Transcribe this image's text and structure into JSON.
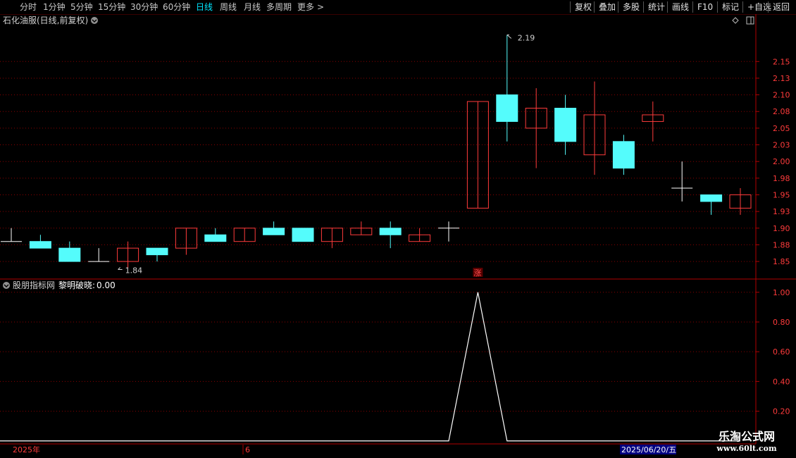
{
  "toolbar": {
    "periods": [
      "分时",
      "1分钟",
      "5分钟",
      "15分钟",
      "30分钟",
      "60分钟",
      "日线",
      "周线",
      "月线",
      "多周期",
      "更多"
    ],
    "active_index": 6,
    "buttons": [
      "复权",
      "叠加",
      "多股",
      "统计",
      "画线",
      "F10",
      "标记",
      "+自选",
      "返回"
    ]
  },
  "main_panel": {
    "title": "石化油服(日线,前复权)",
    "rise_marker": "涨",
    "high_label": "2.19",
    "low_label": "1.84"
  },
  "indicator_panel": {
    "source": "股朋指标网",
    "name": "黎明破晓",
    "value": "0.00"
  },
  "date_bar": {
    "year_label": "2025年",
    "month_label": "6",
    "cursor_date": "2025/06/20/五"
  },
  "watermark": {
    "line1": "乐淘公式网",
    "line2": "www.60lt.com"
  },
  "colors": {
    "up": "#ff3b3b",
    "down": "#54fcfc",
    "flat": "#ffffff",
    "grid": "#8b0000",
    "axis_text": "#ff3b3b",
    "indicator_line": "#ffffff"
  },
  "chart_data": [
    {
      "type": "candlestick",
      "title": "石化油服(日线,前复权)",
      "y_ticks": [
        "1.85",
        "1.88",
        "1.90",
        "1.93",
        "1.95",
        "1.98",
        "2.00",
        "2.03",
        "2.05",
        "2.08",
        "2.10",
        "2.13",
        "2.15"
      ],
      "y_tick_values": [
        1.85,
        1.875,
        1.9,
        1.925,
        1.95,
        1.975,
        2.0,
        2.025,
        2.05,
        2.075,
        2.1,
        2.125,
        2.15
      ],
      "ylim": [
        1.83,
        2.2
      ],
      "candles": [
        {
          "o": 1.88,
          "h": 1.9,
          "l": 1.88,
          "c": 1.88
        },
        {
          "o": 1.88,
          "h": 1.89,
          "l": 1.87,
          "c": 1.87
        },
        {
          "o": 1.87,
          "h": 1.88,
          "l": 1.85,
          "c": 1.85
        },
        {
          "o": 1.85,
          "h": 1.87,
          "l": 1.85,
          "c": 1.85
        },
        {
          "o": 1.85,
          "h": 1.88,
          "l": 1.84,
          "c": 1.87
        },
        {
          "o": 1.87,
          "h": 1.87,
          "l": 1.85,
          "c": 1.86
        },
        {
          "o": 1.87,
          "h": 1.9,
          "l": 1.86,
          "c": 1.9
        },
        {
          "o": 1.89,
          "h": 1.9,
          "l": 1.88,
          "c": 1.88
        },
        {
          "o": 1.88,
          "h": 1.9,
          "l": 1.88,
          "c": 1.9
        },
        {
          "o": 1.9,
          "h": 1.91,
          "l": 1.89,
          "c": 1.89
        },
        {
          "o": 1.9,
          "h": 1.9,
          "l": 1.88,
          "c": 1.88
        },
        {
          "o": 1.88,
          "h": 1.9,
          "l": 1.87,
          "c": 1.9
        },
        {
          "o": 1.89,
          "h": 1.91,
          "l": 1.89,
          "c": 1.9
        },
        {
          "o": 1.9,
          "h": 1.91,
          "l": 1.87,
          "c": 1.89
        },
        {
          "o": 1.88,
          "h": 1.9,
          "l": 1.88,
          "c": 1.89
        },
        {
          "o": 1.9,
          "h": 1.91,
          "l": 1.88,
          "c": 1.9
        },
        {
          "o": 1.93,
          "h": 2.09,
          "l": 1.93,
          "c": 2.09
        },
        {
          "o": 2.1,
          "h": 2.19,
          "l": 2.03,
          "c": 2.06
        },
        {
          "o": 2.05,
          "h": 2.11,
          "l": 1.99,
          "c": 2.08
        },
        {
          "o": 2.08,
          "h": 2.1,
          "l": 2.01,
          "c": 2.03
        },
        {
          "o": 2.01,
          "h": 2.12,
          "l": 1.98,
          "c": 2.07
        },
        {
          "o": 2.03,
          "h": 2.04,
          "l": 1.98,
          "c": 1.99
        },
        {
          "o": 2.06,
          "h": 2.09,
          "l": 2.03,
          "c": 2.07
        },
        {
          "o": 1.96,
          "h": 2.0,
          "l": 1.94,
          "c": 1.96
        },
        {
          "o": 1.95,
          "h": 1.95,
          "l": 1.92,
          "c": 1.94
        },
        {
          "o": 1.93,
          "h": 1.96,
          "l": 1.92,
          "c": 1.95
        }
      ]
    },
    {
      "type": "line",
      "title": "黎明破晓",
      "y_ticks": [
        "0.20",
        "0.40",
        "0.60",
        "0.80",
        "1.00"
      ],
      "y_tick_values": [
        0.2,
        0.4,
        0.6,
        0.8,
        1.0
      ],
      "ylim": [
        -0.02,
        1.07
      ],
      "series": [
        {
          "name": "黎明破晓",
          "values": [
            0,
            0,
            0,
            0,
            0,
            0,
            0,
            0,
            0,
            0,
            0,
            0,
            0,
            0,
            0,
            0,
            1,
            0,
            0,
            0,
            0,
            0,
            0,
            0,
            0,
            0
          ]
        }
      ]
    }
  ]
}
